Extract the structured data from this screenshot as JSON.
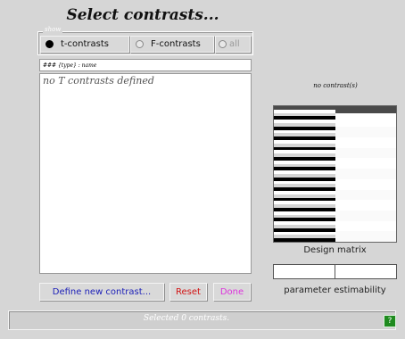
{
  "window": {
    "title": "Select contrasts..."
  },
  "show": {
    "legend": "show",
    "options": [
      {
        "label": "t-contrasts",
        "selected": true
      },
      {
        "label": "F-contrasts",
        "selected": false
      },
      {
        "label": "all",
        "selected": false,
        "disabled": true
      }
    ]
  },
  "list": {
    "header": "### {type} : name",
    "empty_message": "no T contrasts defined"
  },
  "buttons": {
    "define": "Define new contrast...",
    "reset": "Reset",
    "done": "Done"
  },
  "design": {
    "contrast_label": "no contrast(s)",
    "matrix_label": "Design matrix",
    "estimability_label": "parameter estimability"
  },
  "status": {
    "text": "Selected 0 contrasts.",
    "help": "?"
  },
  "colors": {
    "define": "#1d20b8",
    "reset": "#d21414",
    "done": "#dd33dd",
    "help": "#1e8a1e"
  }
}
